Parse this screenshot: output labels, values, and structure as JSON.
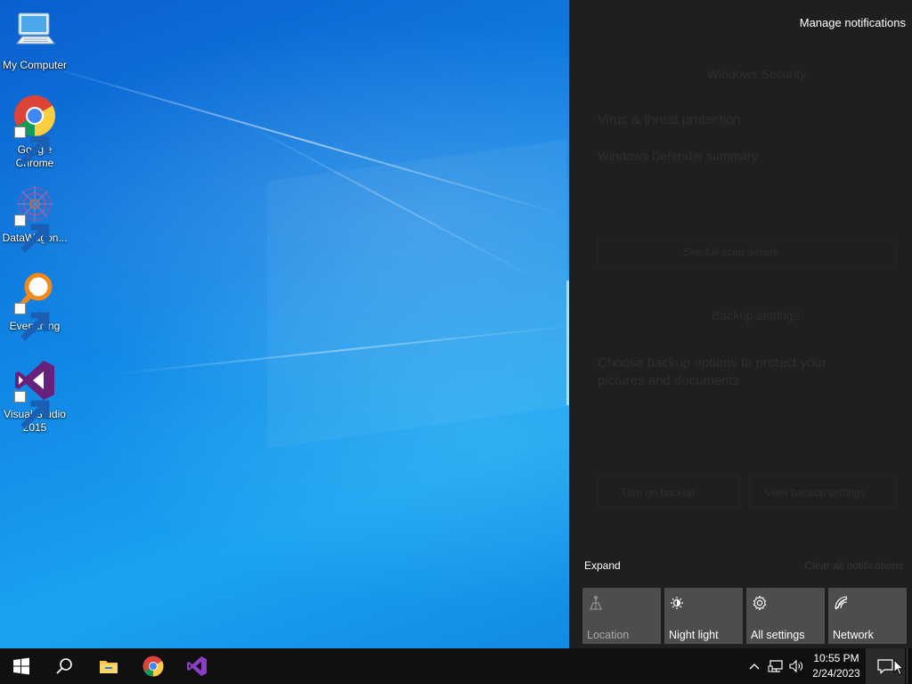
{
  "desktop": {
    "icons": [
      {
        "label": "My Computer",
        "icon": "computer-icon"
      },
      {
        "label": "Google Chrome",
        "icon": "chrome-icon"
      },
      {
        "label": "DataWagon...",
        "icon": "datawagon-icon"
      },
      {
        "label": "Everything",
        "icon": "search-magnifier-icon"
      },
      {
        "label": "Visual Studio 2015",
        "icon": "visual-studio-icon"
      }
    ]
  },
  "action_center": {
    "manage_notifications": "Manage notifications",
    "faded_notifications": {
      "security_header": "Windows Security",
      "virus_heading": "Virus & threat protection",
      "defender_summary": "Windows Defender summary",
      "backup_header": "Backup settings",
      "backup_heading": "Choose backup options to protect your pictures and documents",
      "see_details": "See full scan details",
      "turn_on_backup": "Turn on backup",
      "view_backup": "View backup settings"
    },
    "expand_label": "Expand",
    "clear_all": "Clear all notifications",
    "quick_actions": [
      {
        "label": "Location",
        "icon": "location-icon",
        "enabled": false
      },
      {
        "label": "Night light",
        "icon": "night-light-icon",
        "enabled": true
      },
      {
        "label": "All settings",
        "icon": "gear-icon",
        "enabled": true
      },
      {
        "label": "Network",
        "icon": "network-icon",
        "enabled": true
      }
    ]
  },
  "taskbar": {
    "pinned": [
      "start-icon",
      "search-icon",
      "file-explorer-icon",
      "chrome-icon",
      "visual-studio-icon"
    ],
    "tray": [
      "chevron-up-icon",
      "network-tray-icon",
      "volume-icon"
    ],
    "clock": {
      "time": "10:55 PM",
      "date": "2/24/2023"
    }
  },
  "colors": {
    "action_center_bg": "#1f1f1f",
    "tile_bg": "#4d4d4d",
    "taskbar_bg": "#101010",
    "wallpaper_accent": "#1188e6"
  }
}
